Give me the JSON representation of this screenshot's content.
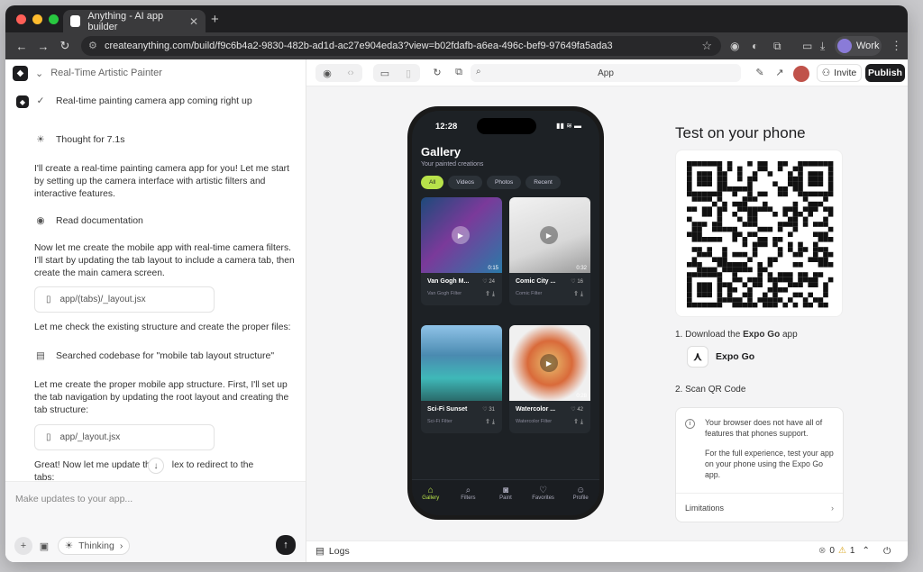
{
  "browser": {
    "tab_title": "Anything - AI app builder",
    "url": "createanything.com/build/f9c6b4a2-9830-482b-ad1d-ac27e904eda3?view=b02fdafb-a6ea-496c-bef9-97649fa5ada3",
    "profile": "Work"
  },
  "project": {
    "name": "Real-Time Artistic Painter"
  },
  "chat": {
    "status_line": "Real-time painting camera app coming right up",
    "thought": "Thought for 7.1s",
    "msg1": "I'll create a real-time painting camera app for you! Let me start by setting up the camera interface with artistic filters and interactive features.",
    "read_docs": "Read documentation",
    "msg2": "Now let me create the mobile app with real-time camera filters. I'll start by updating the tab layout to include a camera tab, then create the main camera screen.",
    "file1": "app/(tabs)/_layout.jsx",
    "msg3": "Let me check the existing structure and create the proper files:",
    "search": "Searched codebase for \"mobile tab layout structure\"",
    "msg4": "Let me create the proper mobile app structure. First, I'll set up the tab navigation by updating the root layout and creating the tab structure:",
    "file2": "app/_layout.jsx",
    "msg5_a": "Great! Now let me update th",
    "msg5_b": "lex to redirect to the tabs:"
  },
  "composer": {
    "placeholder": "Make updates to your app...",
    "thinking_label": "Thinking"
  },
  "preview_toolbar": {
    "address": "App",
    "invite": "Invite",
    "publish": "Publish"
  },
  "bottom": {
    "logs": "Logs",
    "errors": "0",
    "warnings": "1"
  },
  "phone": {
    "time": "12:28",
    "title": "Gallery",
    "subtitle": "Your painted creations",
    "chips": [
      "All",
      "Videos",
      "Photos",
      "Recent"
    ],
    "cards": [
      {
        "title": "Van Gogh M...",
        "likes": "24",
        "filter": "Van Gogh Filter",
        "duration": "0:15"
      },
      {
        "title": "Comic City ...",
        "likes": "16",
        "filter": "Comic Filter",
        "duration": "0:32"
      },
      {
        "title": "Sci-Fi Sunset",
        "likes": "31",
        "filter": "Sci-Fi Filter",
        "duration": ""
      },
      {
        "title": "Watercolor ...",
        "likes": "42",
        "filter": "Watercolor Filter",
        "duration": "0:28"
      }
    ],
    "tabs": [
      "Gallery",
      "Filters",
      "Paint",
      "Favorites",
      "Profile"
    ]
  },
  "test_panel": {
    "title": "Test on your phone",
    "step1_prefix": "1. Download the ",
    "step1_bold": "Expo Go",
    "step1_suffix": " app",
    "expo_label": "Expo Go",
    "step2": "2. Scan QR Code",
    "notice1": "Your browser does not have all of features that phones support.",
    "notice2": "For the full experience, test your app on your phone using the Expo Go app.",
    "limitations": "Limitations"
  },
  "colors": {
    "accent": "#b8e24a",
    "dark": "#1d1d1f"
  }
}
